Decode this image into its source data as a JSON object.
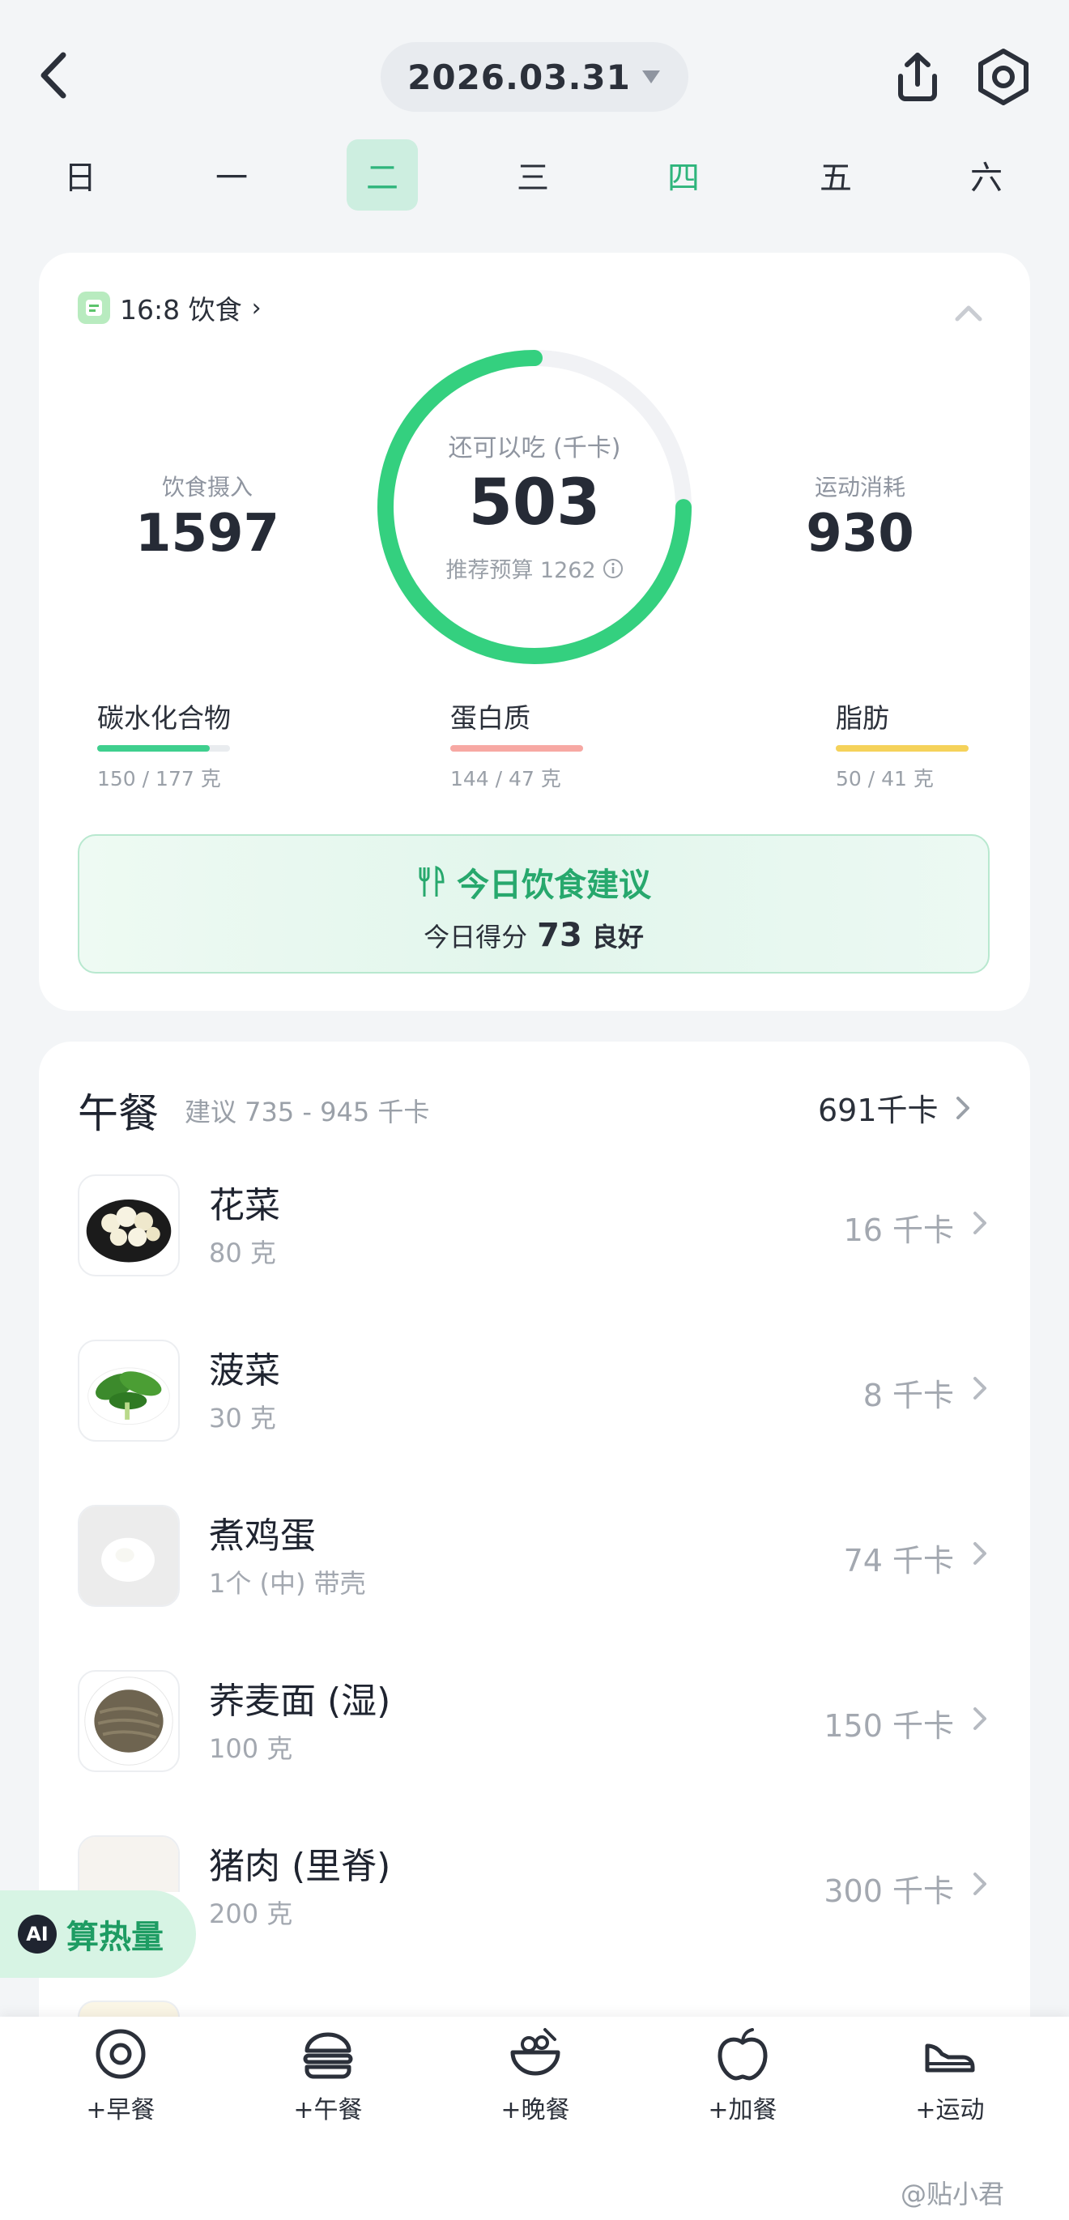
{
  "header": {
    "date": "2026.03.31",
    "back_icon": "chevron-left-icon",
    "share_icon": "share-upload-icon",
    "settings_icon": "gear-icon"
  },
  "weekdays": [
    "日",
    "一",
    "二",
    "三",
    "四",
    "五",
    "六"
  ],
  "selected_weekday_index": 2,
  "highlight_weekday_index": 4,
  "summary": {
    "plan_label": "16:8 饮食",
    "intake_label": "饮食摄入",
    "intake_value": "1597",
    "remaining_label": "还可以吃 (千卡)",
    "remaining_value": "503",
    "budget_label": "推荐预算 1262",
    "remaining_fraction": 0.75,
    "exercise_label": "运动消耗",
    "exercise_value": "930",
    "ring_color": "#34d07f",
    "macros": [
      {
        "name": "碳水化合物",
        "value": "150 / 177 克",
        "fraction": 0.85,
        "color": "#3fcf8e"
      },
      {
        "name": "蛋白质",
        "value": "144 / 47 克",
        "fraction": 1.0,
        "color": "#f7a8a3"
      },
      {
        "name": "脂肪",
        "value": "50 / 41 克",
        "fraction": 1.0,
        "color": "#f5d25a"
      }
    ],
    "advice_title": "今日饮食建议",
    "advice_score_prefix": "今日得分",
    "advice_score": "73",
    "advice_score_grade": "良好"
  },
  "meal": {
    "title": "午餐",
    "suggest": "建议 735 - 945 千卡",
    "total": "691千卡",
    "items": [
      {
        "name": "花菜",
        "amount": "80 克",
        "kcal": "16 千卡",
        "icon": "cauliflower-image"
      },
      {
        "name": "菠菜",
        "amount": "30 克",
        "kcal": "8 千卡",
        "icon": "spinach-image"
      },
      {
        "name": "煮鸡蛋",
        "amount": "1个 (中) 带壳",
        "kcal": "74 千卡",
        "icon": "boiled-egg-image"
      },
      {
        "name": "荞麦面 (湿)",
        "amount": "100 克",
        "kcal": "150 千卡",
        "icon": "buckwheat-noodles-image"
      },
      {
        "name": "猪肉 (里脊)",
        "amount": "200 克",
        "kcal": "300 千卡",
        "icon": "pork-image"
      }
    ]
  },
  "ai_badge": {
    "circle": "AI",
    "label": "算热量"
  },
  "tabs": [
    {
      "label": "+早餐",
      "icon": "egg-icon"
    },
    {
      "label": "+午餐",
      "icon": "burger-icon"
    },
    {
      "label": "+晚餐",
      "icon": "bowl-icon"
    },
    {
      "label": "+加餐",
      "icon": "apple-icon"
    },
    {
      "label": "+运动",
      "icon": "sneaker-icon"
    }
  ],
  "watermark": "@贴小君"
}
